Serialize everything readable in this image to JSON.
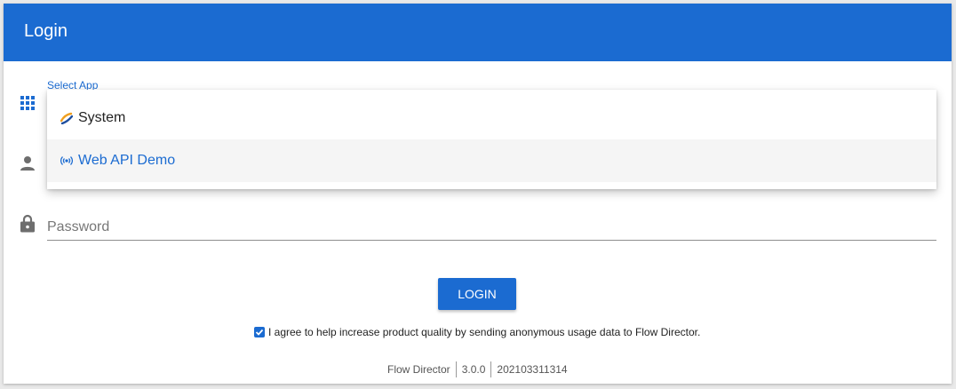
{
  "header": {
    "title": "Login"
  },
  "app_select": {
    "label": "Select App",
    "options": [
      {
        "label": "System",
        "icon": "system-logo-icon"
      },
      {
        "label": "Web API Demo",
        "icon": "broadcast-icon",
        "highlighted": true
      }
    ]
  },
  "fields": {
    "app_icon": "apps-grid-icon",
    "user_icon": "person-icon",
    "password_icon": "lock-icon",
    "password_placeholder": "Password"
  },
  "actions": {
    "login_label": "LOGIN"
  },
  "consent": {
    "checked": true,
    "text": "I agree to help increase product quality by sending anonymous usage data to Flow Director."
  },
  "footer": {
    "product": "Flow Director",
    "version": "3.0.0",
    "build": "202103311314"
  },
  "colors": {
    "primary": "#1b6bd1",
    "header_text": "#ffffff",
    "highlight_bg": "#f5f5f5",
    "system_icon_orange": "#f0a020",
    "system_icon_blue": "#1f4f9e"
  }
}
